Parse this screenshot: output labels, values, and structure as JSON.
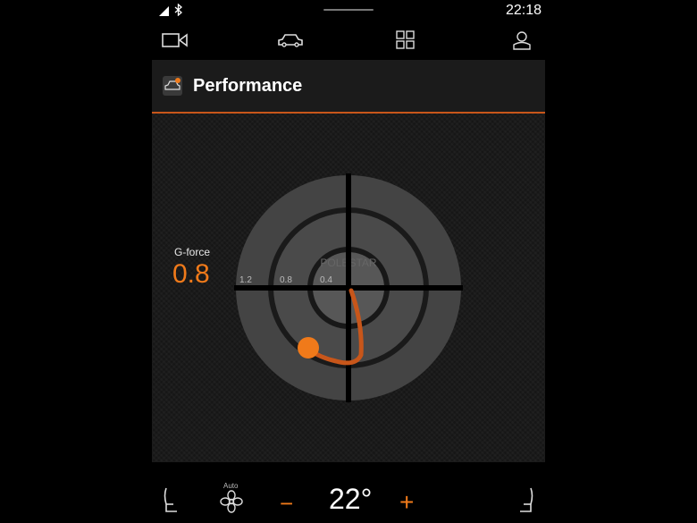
{
  "status_bar": {
    "time": "22:18",
    "icons": [
      "signal-icon",
      "bluetooth-icon"
    ]
  },
  "nav": {
    "items": [
      "camera-icon",
      "car-icon",
      "apps-grid-icon",
      "profile-icon"
    ]
  },
  "app": {
    "title": "Performance",
    "icon": "car-performance-icon"
  },
  "gforce": {
    "label": "G-force",
    "value": "0.8",
    "ring_labels": [
      "1.2",
      "0.8",
      "0.4"
    ],
    "center_logo_text": "POLESTAR",
    "accent_color": "#f07a1a"
  },
  "climate": {
    "mode_label": "Auto",
    "temperature": "22°",
    "minus": "−",
    "plus": "+",
    "icons": [
      "seat-heat-left-icon",
      "fan-icon",
      "seat-heat-right-icon"
    ]
  }
}
